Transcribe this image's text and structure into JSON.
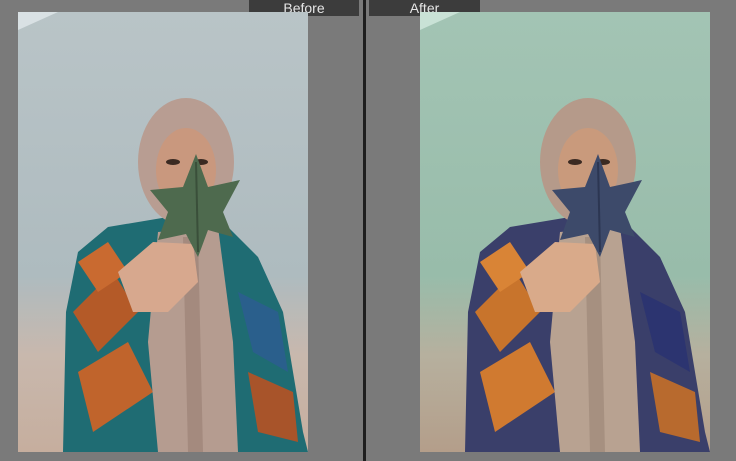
{
  "compare": {
    "before_label": "Before",
    "after_label": "After"
  },
  "colors": {
    "canvas": "#7a7a7a",
    "divider": "#1e1e1e",
    "label_bg": "#3c3c3c",
    "label_text": "#e6e6e6",
    "before_background": "#b7c2c5",
    "after_background": "#9fc0b0",
    "before_leaf": "#4e6a4e",
    "after_leaf": "#3d4a6a",
    "before_poncho": "#1f6c73",
    "after_poncho": "#3a3f6a",
    "scarf": "#b59c90"
  },
  "icons": [
    "woman-photo-before",
    "woman-photo-after"
  ]
}
